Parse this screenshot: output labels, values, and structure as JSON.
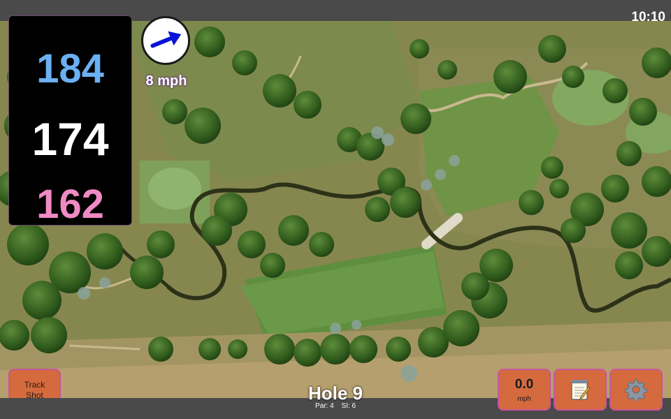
{
  "status": {
    "time": "10:10"
  },
  "distances": {
    "back": "184",
    "middle": "174",
    "front": "162"
  },
  "wind": {
    "speed_label": "8 mph",
    "arrow_direction": "east-northeast"
  },
  "hole": {
    "title": "Hole 9",
    "par": "Par: 4",
    "si": "SI: 6"
  },
  "buttons": {
    "track_shot": "Track\nShot",
    "speed_value": "0.0",
    "speed_unit": "mph",
    "notes_icon": "notepad-icon",
    "settings_icon": "gear-icon"
  },
  "colors": {
    "back_distance": "#6bb0f2",
    "middle_distance": "#ffffff",
    "front_distance": "#f08ac3",
    "button_fill": "#d46a3e",
    "button_border": "#c8559b",
    "wind_arrow": "#0a14d6"
  }
}
